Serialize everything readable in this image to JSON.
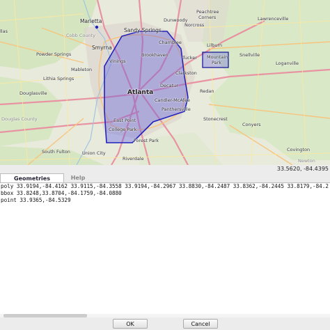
{
  "map": {
    "labels": {
      "marietta": "Marietta",
      "sandy_springs": "Sandy Springs",
      "peachtree_corners_1": "Peachtree",
      "peachtree_corners_2": "Corners",
      "dunwoody": "Dunwoody",
      "norcross": "Norcross",
      "lawrenceville": "Lawrenceville",
      "smyrna": "Smyrna",
      "chamblee": "Chamblee",
      "lilburn": "Lilburn",
      "powder_springs": "Powder Springs",
      "brookhaven": "Brookhaven",
      "mountain_park_1": "Mountain",
      "mountain_park_2": "Park",
      "snellville": "Snellville",
      "tucker": "Tucker",
      "vinings": "Vinings",
      "mableton": "Mableton",
      "loganville": "Loganville",
      "clarkston": "Clarkston",
      "lithia_springs": "Lithia Springs",
      "atlanta": "Atlanta",
      "decatur": "Decatur",
      "redan": "Redan",
      "douglasville": "Douglasville",
      "candler": "Candler-McAfee",
      "panthersville": "Panthersville",
      "stonecrest": "Stonecrest",
      "east_point": "East Point",
      "college_park": "College Park",
      "conyers": "Conyers",
      "forest_park": "Forest Park",
      "south_fulton": "South Fulton",
      "union_city": "Union City",
      "riverdale": "Riverdale",
      "covington": "Covington",
      "dallas": "llas",
      "cobb": "Cobb County",
      "douglas": "Douglas County",
      "newton": "Newton"
    }
  },
  "status": {
    "coordinates": "33.5620, -84.4395"
  },
  "tabs": {
    "geometries": "Geometries",
    "help": "Help"
  },
  "editor": {
    "lines": [
      "poly 33.9194,-84.4162 33.9115,-84.3558 33.9194,-84.2967 33.8830,-84.2487 33.8362,-84.2445 33.8179,-84.2",
      "bbox 33.8248,33.8704,-84.1759,-84.0880",
      "point 33.9365,-84.5329"
    ]
  },
  "buttons": {
    "ok": "OK",
    "cancel": "Cancel"
  }
}
